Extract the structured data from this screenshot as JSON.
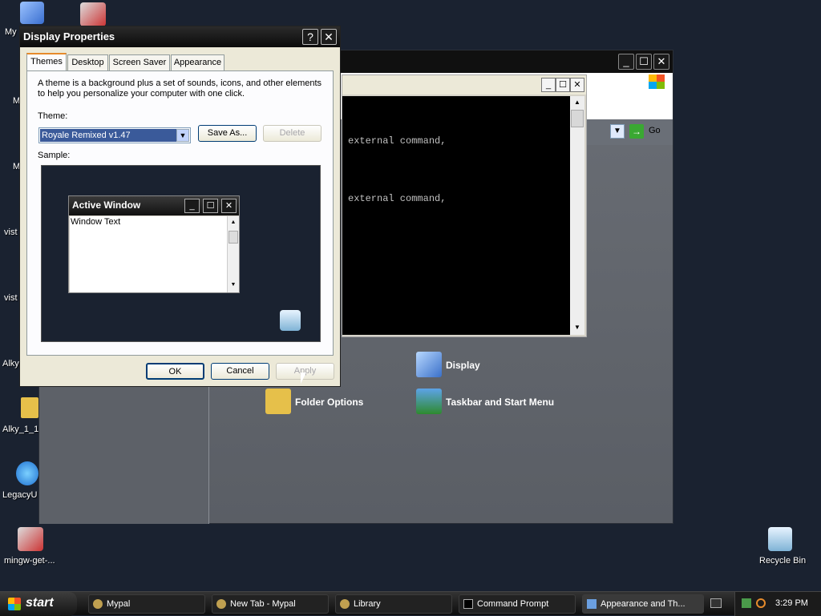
{
  "desktop": {
    "icons": [
      {
        "label": "My",
        "icon": "my-computer-icon"
      },
      {
        "label": "M",
        "icon": "generic-icon"
      },
      {
        "label": "M",
        "icon": "generic-icon"
      },
      {
        "label": "vist",
        "icon": "generic-icon"
      },
      {
        "label": "vist",
        "icon": "generic-icon"
      },
      {
        "label": "Alky",
        "icon": "generic-icon"
      },
      {
        "label": "Alky_1_1",
        "icon": "folder-icon"
      },
      {
        "label": "LegacyU",
        "icon": "update-icon"
      },
      {
        "label": "mingw-get-...",
        "icon": "installer-icon"
      },
      {
        "label": "Recycle Bin",
        "icon": "recycle-bin-icon"
      }
    ]
  },
  "control_panel": {
    "go_label": "Go",
    "items": [
      {
        "label": "Display",
        "icon": "display-icon"
      },
      {
        "label": "Folder Options",
        "icon": "folder-options-icon"
      },
      {
        "label": "Taskbar and Start Menu",
        "icon": "taskbar-icon"
      }
    ]
  },
  "cmd": {
    "lines": [
      "external command,",
      "external command,"
    ]
  },
  "display_properties": {
    "title": "Display Properties",
    "tabs": [
      "Themes",
      "Desktop",
      "Screen Saver",
      "Appearance"
    ],
    "description_line1": "A theme is a background plus a set of sounds, icons, and other elements",
    "description_line2": "to help you personalize your computer with one click.",
    "theme_label": "Theme:",
    "theme_value": "Royale Remixed v1.47",
    "save_as_label": "Save As...",
    "delete_label": "Delete",
    "sample_label": "Sample:",
    "sample_window": {
      "title": "Active Window",
      "body_text": "Window Text"
    },
    "ok_label": "OK",
    "cancel_label": "Cancel",
    "apply_label": "Apply"
  },
  "taskbar": {
    "start_label": "start",
    "tasks": [
      {
        "label": "Mypal"
      },
      {
        "label": "New Tab - Mypal"
      },
      {
        "label": "Library"
      },
      {
        "label": "Command Prompt"
      },
      {
        "label": "Appearance and Th..."
      }
    ],
    "clock": "3:29 PM"
  },
  "colors": {
    "desktop": "#1a2230",
    "accent": "#e68b2c"
  }
}
